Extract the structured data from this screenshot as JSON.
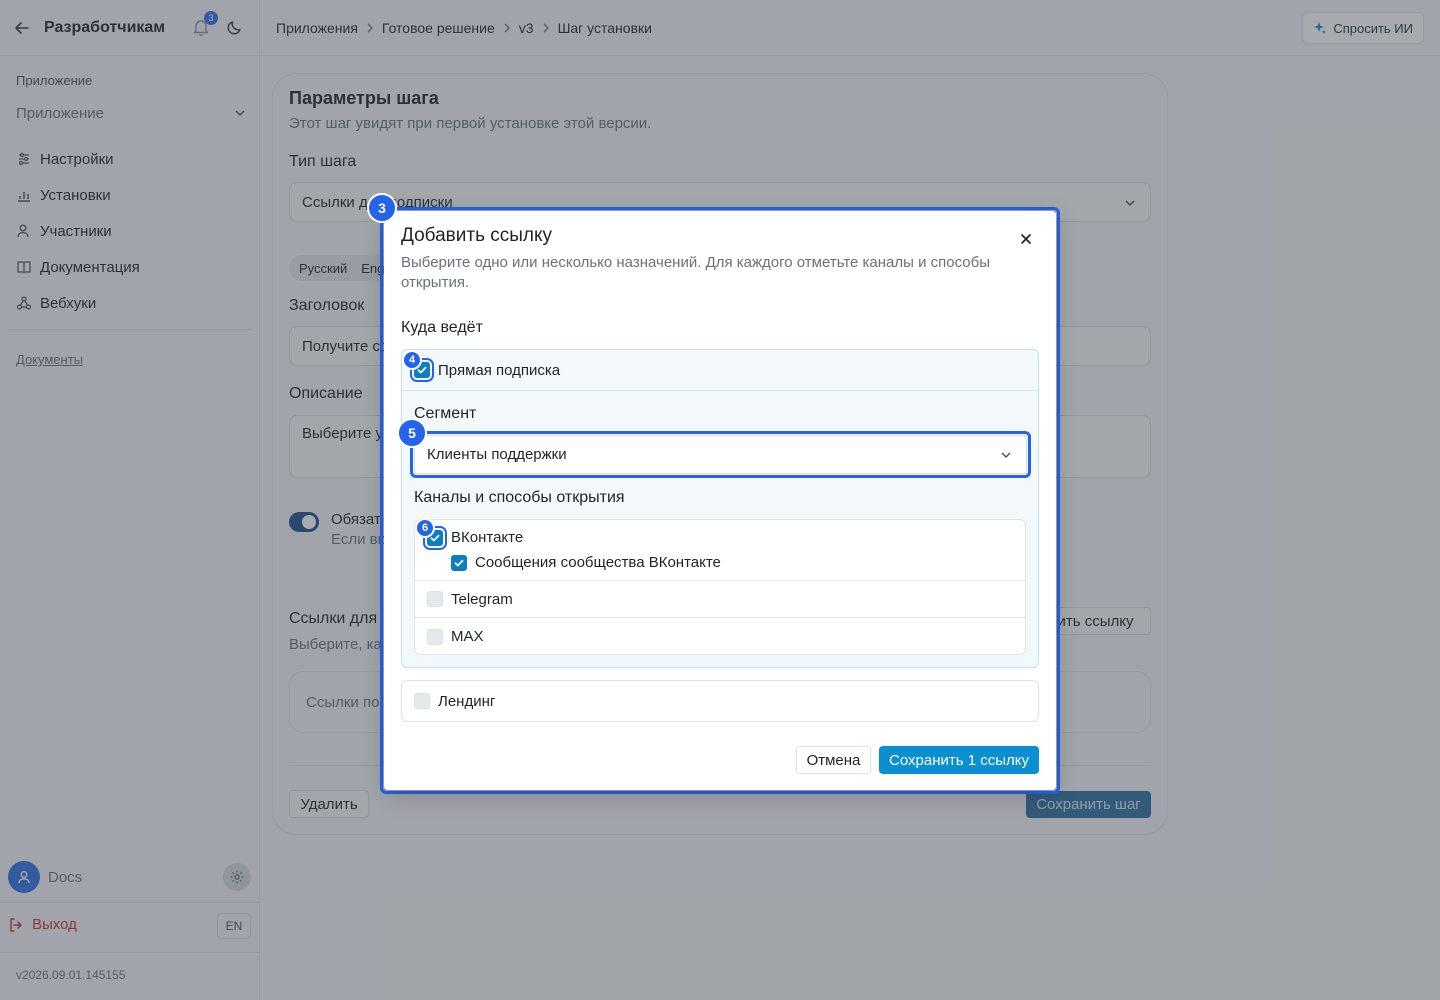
{
  "sidebar": {
    "title": "Разработчикам",
    "notification_count": "3",
    "section_label": "Приложение",
    "app_select": "Приложение",
    "nav": [
      {
        "label": "Настройки",
        "icon": "settings-icon"
      },
      {
        "label": "Установки",
        "icon": "chart-icon"
      },
      {
        "label": "Участники",
        "icon": "users-icon"
      },
      {
        "label": "Документация",
        "icon": "book-icon"
      },
      {
        "label": "Вебхуки",
        "icon": "webhook-icon"
      }
    ],
    "docs_link": "Документы",
    "user_name": "Docs",
    "logout": "Выход",
    "lang": "EN",
    "version": "v2026.09.01.145155"
  },
  "topbar": {
    "breadcrumbs": [
      "Приложения",
      "Готовое решение",
      "v3",
      "Шаг установки"
    ],
    "ask_ai": "Спросить ИИ"
  },
  "page": {
    "title": "Параметры шага",
    "subtitle": "Этот шаг увидят при первой установке этой версии.",
    "step_type_label": "Тип шага",
    "step_type_value": "Ссылки для подписки",
    "lang_tabs": [
      "Русский",
      "Eng"
    ],
    "heading_label": "Заголовок",
    "heading_value": "Получите со",
    "description_label": "Описание",
    "description_value": "Выберите у",
    "toggle_label": "Обязат",
    "toggle_hint": "Если вк",
    "links_label": "Ссылки для",
    "links_hint": "Выберите, ка",
    "add_link_btn": "ить ссылку",
    "empty_links": "Ссылки по",
    "delete_btn": "Удалить",
    "save_step_btn": "Сохранить шаг"
  },
  "modal": {
    "title": "Добавить ссылку",
    "description": "Выберите одно или несколько назначений. Для каждого отметьте каналы и способы открытия.",
    "destination_label": "Куда ведёт",
    "direct_subscription": {
      "label": "Прямая подписка",
      "checked": true
    },
    "segment_label": "Сегмент",
    "segment_value": "Клиенты поддержки",
    "channels_label": "Каналы и способы открытия",
    "channels": [
      {
        "label": "ВКонтакте",
        "checked": true,
        "sub": [
          {
            "label": "Сообщения сообщества ВКонтакте",
            "checked": true
          }
        ]
      },
      {
        "label": "Telegram",
        "checked": false
      },
      {
        "label": "MAX",
        "checked": false
      }
    ],
    "landing": {
      "label": "Лендинг",
      "checked": false
    },
    "cancel": "Отмена",
    "save": "Сохранить 1 ссылку"
  },
  "markers": [
    "3",
    "4",
    "5",
    "6"
  ],
  "colors": {
    "accent": "#0a8fd0",
    "marker": "#2563eb",
    "checkbox": "#0b7fc2"
  }
}
